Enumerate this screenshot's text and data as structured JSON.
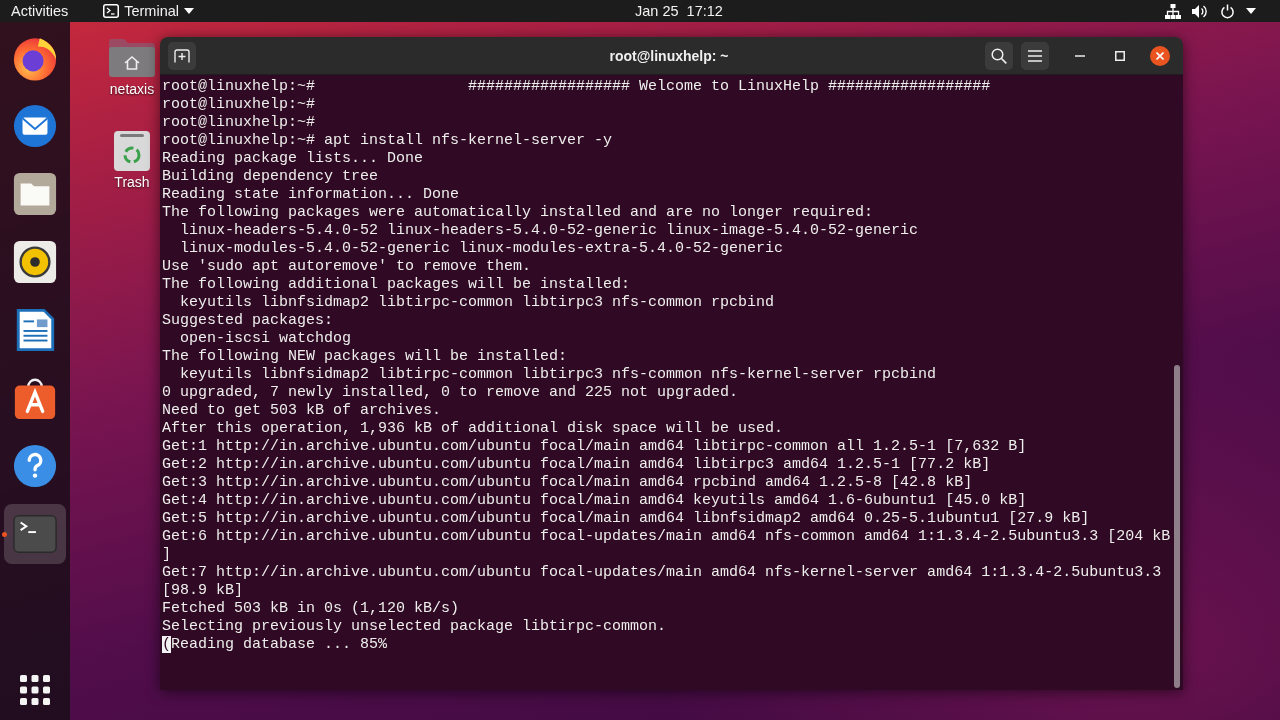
{
  "top_bar": {
    "activities": "Activities",
    "app_menu": "Terminal",
    "clock": "Jan 25  17:12"
  },
  "dock": {
    "items": [
      {
        "kind": "browser",
        "running": false,
        "selected": false
      },
      {
        "kind": "mail",
        "running": false,
        "selected": false
      },
      {
        "kind": "files",
        "running": false,
        "selected": false
      },
      {
        "kind": "music",
        "running": false,
        "selected": false
      },
      {
        "kind": "writer",
        "running": false,
        "selected": false
      },
      {
        "kind": "store",
        "running": false,
        "selected": false
      },
      {
        "kind": "help",
        "running": false,
        "selected": false
      },
      {
        "kind": "terminal",
        "running": true,
        "selected": true
      }
    ]
  },
  "desktop_icons": [
    {
      "kind": "home",
      "label": "netaxis"
    },
    {
      "kind": "trash",
      "label": "Trash"
    }
  ],
  "terminal": {
    "title": "root@linuxhelp: ~",
    "lines": [
      {
        "text": "root@linuxhelp:~#                 ################## Welcome to LinuxHelp ##################",
        "cursor": false
      },
      {
        "text": "root@linuxhelp:~#",
        "cursor": false
      },
      {
        "text": "root@linuxhelp:~#",
        "cursor": false
      },
      {
        "text": "root@linuxhelp:~# apt install nfs-kernel-server -y",
        "cursor": false
      },
      {
        "text": "Reading package lists... Done",
        "cursor": false
      },
      {
        "text": "Building dependency tree",
        "cursor": false
      },
      {
        "text": "Reading state information... Done",
        "cursor": false
      },
      {
        "text": "The following packages were automatically installed and are no longer required:",
        "cursor": false
      },
      {
        "text": "  linux-headers-5.4.0-52 linux-headers-5.4.0-52-generic linux-image-5.4.0-52-generic",
        "cursor": false
      },
      {
        "text": "  linux-modules-5.4.0-52-generic linux-modules-extra-5.4.0-52-generic",
        "cursor": false
      },
      {
        "text": "Use 'sudo apt autoremove' to remove them.",
        "cursor": false
      },
      {
        "text": "The following additional packages will be installed:",
        "cursor": false
      },
      {
        "text": "  keyutils libnfsidmap2 libtirpc-common libtirpc3 nfs-common rpcbind",
        "cursor": false
      },
      {
        "text": "Suggested packages:",
        "cursor": false
      },
      {
        "text": "  open-iscsi watchdog",
        "cursor": false
      },
      {
        "text": "The following NEW packages will be installed:",
        "cursor": false
      },
      {
        "text": "  keyutils libnfsidmap2 libtirpc-common libtirpc3 nfs-common nfs-kernel-server rpcbind",
        "cursor": false
      },
      {
        "text": "0 upgraded, 7 newly installed, 0 to remove and 225 not upgraded.",
        "cursor": false
      },
      {
        "text": "Need to get 503 kB of archives.",
        "cursor": false
      },
      {
        "text": "After this operation, 1,936 kB of additional disk space will be used.",
        "cursor": false
      },
      {
        "text": "Get:1 http://in.archive.ubuntu.com/ubuntu focal/main amd64 libtirpc-common all 1.2.5-1 [7,632 B]",
        "cursor": false
      },
      {
        "text": "Get:2 http://in.archive.ubuntu.com/ubuntu focal/main amd64 libtirpc3 amd64 1.2.5-1 [77.2 kB]",
        "cursor": false
      },
      {
        "text": "Get:3 http://in.archive.ubuntu.com/ubuntu focal/main amd64 rpcbind amd64 1.2.5-8 [42.8 kB]",
        "cursor": false
      },
      {
        "text": "Get:4 http://in.archive.ubuntu.com/ubuntu focal/main amd64 keyutils amd64 1.6-6ubuntu1 [45.0 kB]",
        "cursor": false
      },
      {
        "text": "Get:5 http://in.archive.ubuntu.com/ubuntu focal/main amd64 libnfsidmap2 amd64 0.25-5.1ubuntu1 [27.9 kB]",
        "cursor": false
      },
      {
        "text": "Get:6 http://in.archive.ubuntu.com/ubuntu focal-updates/main amd64 nfs-common amd64 1:1.3.4-2.5ubuntu3.3 [204 kB",
        "cursor": false
      },
      {
        "text": "]",
        "cursor": false
      },
      {
        "text": "Get:7 http://in.archive.ubuntu.com/ubuntu focal-updates/main amd64 nfs-kernel-server amd64 1:1.3.4-2.5ubuntu3.3",
        "cursor": false
      },
      {
        "text": "[98.9 kB]",
        "cursor": false
      },
      {
        "text": "Fetched 503 kB in 0s (1,120 kB/s)",
        "cursor": false
      },
      {
        "text": "Selecting previously unselected package libtirpc-common.",
        "cursor": false
      },
      {
        "text": "(Reading database ... 85%",
        "cursor": true
      }
    ]
  }
}
